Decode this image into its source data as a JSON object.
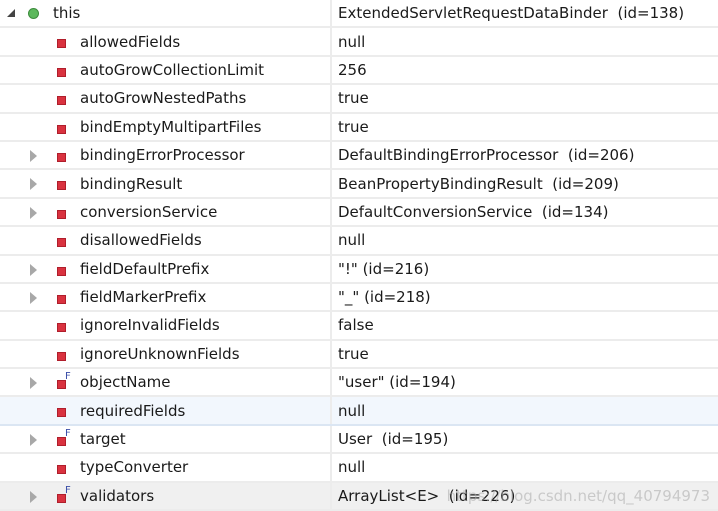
{
  "variables": [
    {
      "name": "this",
      "value": "ExtendedServletRequestDataBinder  (id=138)",
      "icon": "object-green-circle",
      "expand": "expanded"
    },
    {
      "name": "allowedFields",
      "value": "null",
      "icon": "private-field",
      "expand": "none"
    },
    {
      "name": "autoGrowCollectionLimit",
      "value": "256",
      "icon": "private-field",
      "expand": "none"
    },
    {
      "name": "autoGrowNestedPaths",
      "value": "true",
      "icon": "private-field",
      "expand": "none"
    },
    {
      "name": "bindEmptyMultipartFiles",
      "value": "true",
      "icon": "private-field",
      "expand": "none"
    },
    {
      "name": "bindingErrorProcessor",
      "value": "DefaultBindingErrorProcessor  (id=206)",
      "icon": "private-field",
      "expand": "collapsed"
    },
    {
      "name": "bindingResult",
      "value": "BeanPropertyBindingResult  (id=209)",
      "icon": "private-field",
      "expand": "collapsed"
    },
    {
      "name": "conversionService",
      "value": "DefaultConversionService  (id=134)",
      "icon": "private-field",
      "expand": "collapsed"
    },
    {
      "name": "disallowedFields",
      "value": "null",
      "icon": "private-field",
      "expand": "none"
    },
    {
      "name": "fieldDefaultPrefix",
      "value": "\"!\" (id=216)",
      "icon": "private-field",
      "expand": "collapsed"
    },
    {
      "name": "fieldMarkerPrefix",
      "value": "\"_\" (id=218)",
      "icon": "private-field",
      "expand": "collapsed"
    },
    {
      "name": "ignoreInvalidFields",
      "value": "false",
      "icon": "private-field",
      "expand": "none"
    },
    {
      "name": "ignoreUnknownFields",
      "value": "true",
      "icon": "private-field",
      "expand": "none"
    },
    {
      "name": "objectName",
      "value": "\"user\" (id=194)",
      "icon": "private-final-field",
      "expand": "collapsed"
    },
    {
      "name": "requiredFields",
      "value": "null",
      "icon": "private-field",
      "expand": "none",
      "selected": true
    },
    {
      "name": "target",
      "value": "User  (id=195)",
      "icon": "private-final-field",
      "expand": "collapsed"
    },
    {
      "name": "typeConverter",
      "value": "null",
      "icon": "private-field",
      "expand": "none"
    },
    {
      "name": "validators",
      "value": "ArrayList<E>  (id=226)",
      "icon": "private-final-field",
      "expand": "collapsed"
    }
  ],
  "watermark": "https://blog.csdn.net/qq_40794973"
}
